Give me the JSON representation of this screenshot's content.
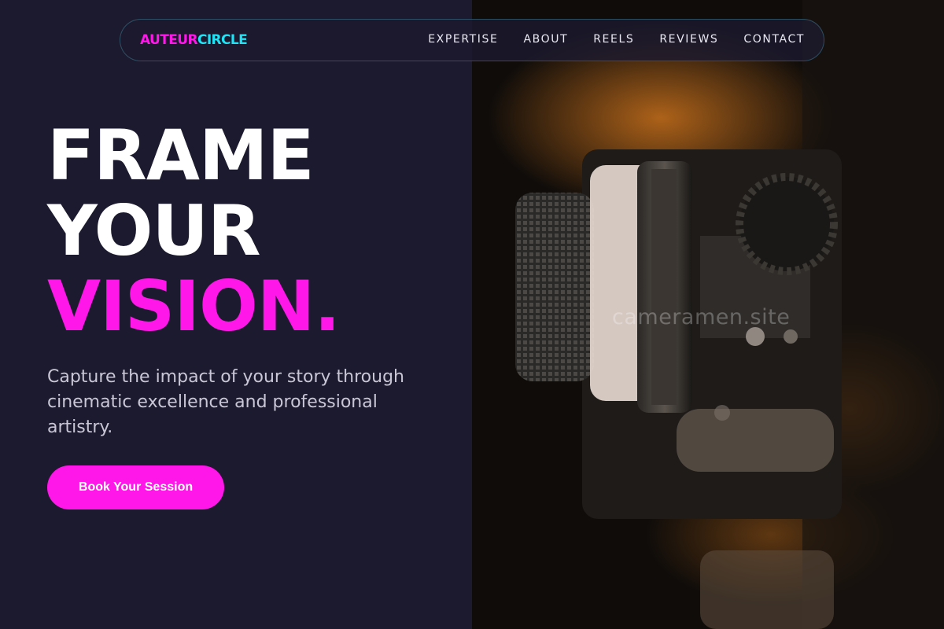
{
  "brand": {
    "part1": "AUTEUR",
    "part2": "CIRCLE",
    "color1": "#ff16e9",
    "color2": "#1ee3f5"
  },
  "nav": {
    "items": [
      {
        "label": "EXPERTISE"
      },
      {
        "label": "ABOUT"
      },
      {
        "label": "REELS"
      },
      {
        "label": "REVIEWS"
      },
      {
        "label": "CONTACT"
      }
    ]
  },
  "hero": {
    "line1": "FRAME",
    "line2": "YOUR",
    "line3": "VISION.",
    "subtitle": "Capture the impact of your story through cinematic excellence and professional artistry.",
    "cta_label": "Book Your Session"
  },
  "image": {
    "watermark": "cameramen.site",
    "subject": "camera-lens-closeup"
  },
  "colors": {
    "background": "#1c1a2e",
    "accent": "#ff16e9"
  }
}
